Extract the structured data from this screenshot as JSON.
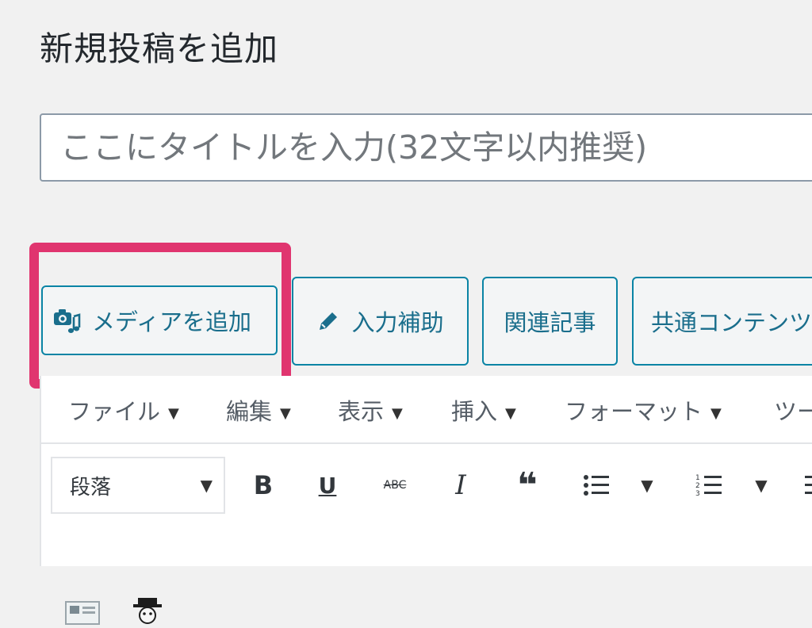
{
  "page": {
    "title": "新規投稿を追加"
  },
  "title_field": {
    "placeholder": "ここにタイトルを入力(32文字以内推奨)"
  },
  "buttons": {
    "add_media": "メディアを追加",
    "input_assist": "入力補助",
    "related_articles": "関連記事",
    "common_content": "共通コンテンツ"
  },
  "menubar": {
    "items": [
      "ファイル",
      "編集",
      "表示",
      "挿入",
      "フォーマット",
      "ツール"
    ],
    "caret": "▼"
  },
  "toolbar": {
    "format_value": "段落",
    "bold": "B",
    "underline": "U",
    "strikethrough": "ABC",
    "italic": "I",
    "quote": "❝",
    "caret": "▼"
  },
  "colors": {
    "accent": "#0a84a5",
    "highlight": "#e0356f",
    "background": "#f1f1f1"
  }
}
